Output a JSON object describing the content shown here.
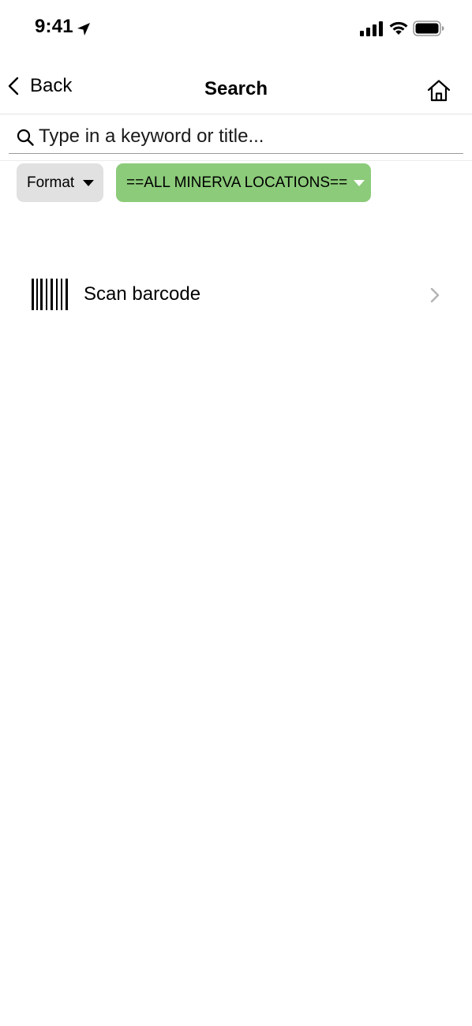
{
  "status_bar": {
    "time": "9:41",
    "icons": [
      "location-arrow-icon",
      "cellular-signal-icon",
      "wifi-icon",
      "battery-icon"
    ]
  },
  "nav": {
    "back_label": "Back",
    "title": "Search",
    "home_icon": "home-icon"
  },
  "search": {
    "placeholder": "Type in a keyword or title...",
    "value": "",
    "icon": "search-icon"
  },
  "filters": {
    "format_label": "Format",
    "location_label": "==ALL MINERVA LOCATIONS==",
    "location_color": "#8ccb7a",
    "format_color": "#e1e1e1"
  },
  "scan": {
    "label": "Scan barcode",
    "icon": "barcode-icon"
  }
}
